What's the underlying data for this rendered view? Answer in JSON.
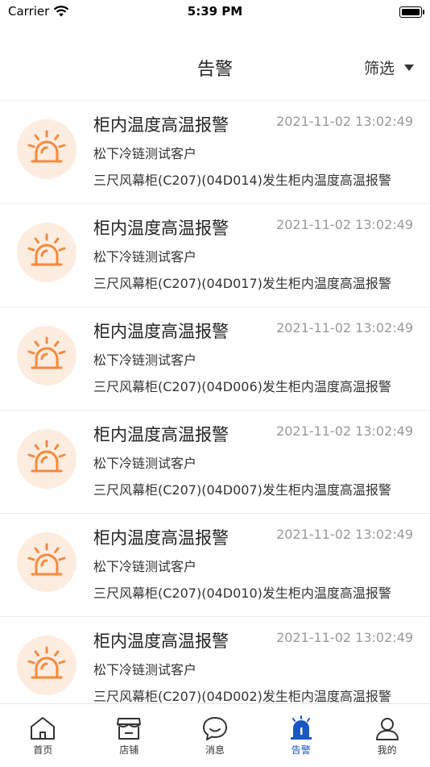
{
  "status_bar": {
    "carrier": "Carrier",
    "time": "5:39 PM"
  },
  "header": {
    "title": "告警",
    "filter_label": "筛选"
  },
  "alarms": [
    {
      "title": "柜内温度高温报警",
      "time": "2021-11-02 13:02:49",
      "customer": "松下冷链测试客户",
      "description": "三尺风幕柜(C207)(04D014)发生柜内温度高温报警"
    },
    {
      "title": "柜内温度高温报警",
      "time": "2021-11-02 13:02:49",
      "customer": "松下冷链测试客户",
      "description": "三尺风幕柜(C207)(04D017)发生柜内温度高温报警"
    },
    {
      "title": "柜内温度高温报警",
      "time": "2021-11-02 13:02:49",
      "customer": "松下冷链测试客户",
      "description": "三尺风幕柜(C207)(04D006)发生柜内温度高温报警"
    },
    {
      "title": "柜内温度高温报警",
      "time": "2021-11-02 13:02:49",
      "customer": "松下冷链测试客户",
      "description": "三尺风幕柜(C207)(04D007)发生柜内温度高温报警"
    },
    {
      "title": "柜内温度高温报警",
      "time": "2021-11-02 13:02:49",
      "customer": "松下冷链测试客户",
      "description": "三尺风幕柜(C207)(04D010)发生柜内温度高温报警"
    },
    {
      "title": "柜内温度高温报警",
      "time": "2021-11-02 13:02:49",
      "customer": "松下冷链测试客户",
      "description": "三尺风幕柜(C207)(04D002)发生柜内温度高温报警"
    }
  ],
  "tabs": [
    {
      "label": "首页",
      "icon": "home-icon",
      "active": false
    },
    {
      "label": "店铺",
      "icon": "store-icon",
      "active": false
    },
    {
      "label": "消息",
      "icon": "message-icon",
      "active": false
    },
    {
      "label": "告警",
      "icon": "alarm-icon",
      "active": true
    },
    {
      "label": "我的",
      "icon": "profile-icon",
      "active": false
    }
  ],
  "colors": {
    "alarm_orange": "#f58a3c",
    "alarm_bg": "#fdece0",
    "active_blue": "#1a56c4"
  }
}
